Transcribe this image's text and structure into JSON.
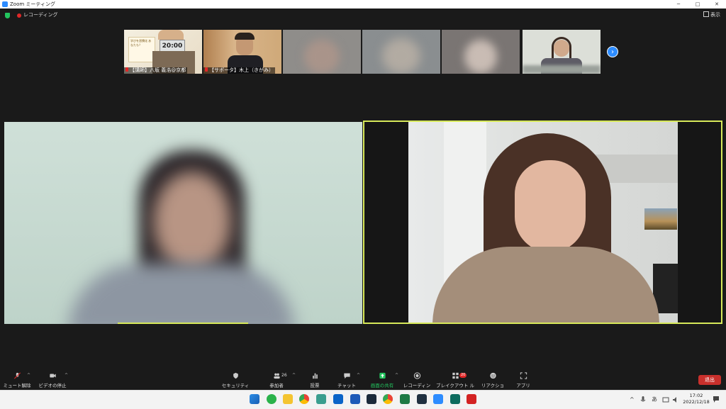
{
  "window": {
    "title": "Zoom ミーティング",
    "minimize": "─",
    "maximize": "□",
    "close": "✕"
  },
  "status": {
    "recording_label": "レコーディング",
    "view_label": "表示"
  },
  "thumbnails": [
    {
      "name": "【講師】八坂 義浩@京都",
      "clock_text": "20:00",
      "board_text": "学びを習慣化 あなたも？"
    },
    {
      "name": "【サポータ】木上（きがみ）"
    },
    {
      "name": ""
    },
    {
      "name": ""
    },
    {
      "name": ""
    },
    {
      "name": ""
    }
  ],
  "toolbar": {
    "mute": "ミュート解除",
    "video": "ビデオの停止",
    "security": "セキュリティ",
    "participants": "参加者",
    "participants_count": "26",
    "polls": "投票",
    "chat": "チャット",
    "share": "画面の共有",
    "record": "レコーディング",
    "breakout": "ブレイクアウト ルーム",
    "breakout_badge": "20",
    "reactions": "リアクション",
    "apps": "アプリ",
    "leave": "退出"
  },
  "taskbar": {
    "tray_caret": "^",
    "ime": "あ",
    "time": "17:02",
    "date": "2022/12/18"
  },
  "colors": {
    "active_speaker_border": "#d7e95a",
    "leave": "#c9302c",
    "share": "#23c45e",
    "accent": "#2d8cff"
  }
}
